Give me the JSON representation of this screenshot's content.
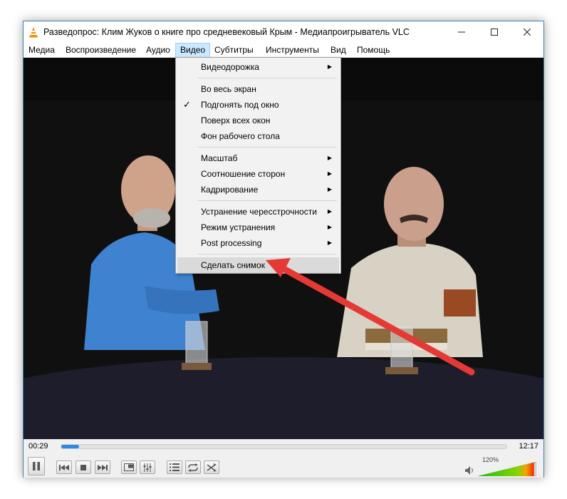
{
  "window": {
    "title": "Разведопрос: Клим Жуков о книге про средневековый Крым - Медиапроигрыватель VLC"
  },
  "menubar": {
    "items": [
      "Медиа",
      "Воспроизведение",
      "Аудио",
      "Видео",
      "Субтитры",
      "Инструменты",
      "Вид",
      "Помощь"
    ],
    "active": "Видео"
  },
  "video_menu": {
    "items": [
      {
        "label": "Видеодорожка",
        "submenu": true
      },
      {
        "label": "Во весь экран"
      },
      {
        "label": "Подгонять под окно",
        "checked": true
      },
      {
        "label": "Поверх всех окон"
      },
      {
        "label": "Фон рабочего стола"
      },
      {
        "label": "Масштаб",
        "submenu": true
      },
      {
        "label": "Соотношение сторон",
        "submenu": true
      },
      {
        "label": "Кадрирование",
        "submenu": true
      },
      {
        "label": "Устранение чересстрочности",
        "submenu": true
      },
      {
        "label": "Режим устранения",
        "submenu": true
      },
      {
        "label": "Post processing",
        "submenu": true
      },
      {
        "label": "Сделать снимок",
        "highlighted": true
      }
    ]
  },
  "playback": {
    "elapsed": "00:29",
    "total": "12:17",
    "progress": 0.04,
    "volume_label": "120%",
    "volume": 1.2
  },
  "colors": {
    "accent": "#2a8be0",
    "annotation_arrow": "#e53935",
    "menu_highlight": "#cce8ff"
  },
  "icons": [
    "vlc-cone-icon",
    "minimize-icon",
    "maximize-icon",
    "close-icon",
    "pause-icon",
    "previous-icon",
    "stop-icon",
    "next-icon",
    "fullscreen-icon",
    "extended-settings-icon",
    "playlist-icon",
    "loop-icon",
    "shuffle-icon",
    "speaker-icon"
  ]
}
